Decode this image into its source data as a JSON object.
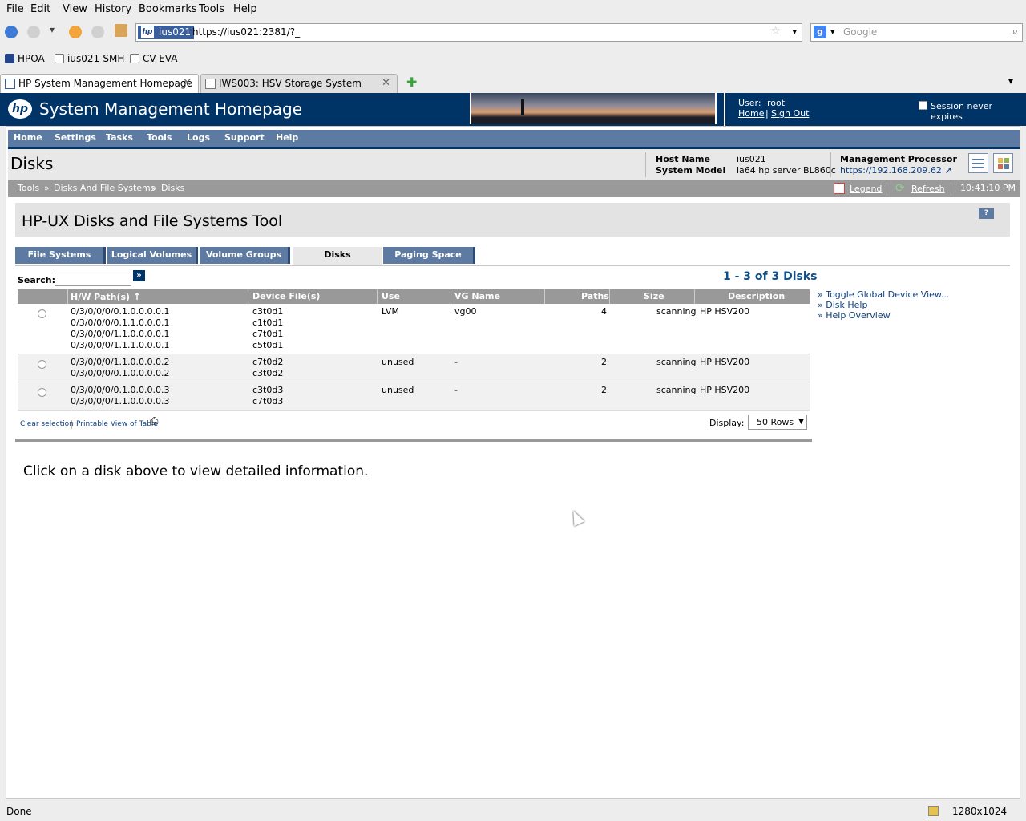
{
  "browser": {
    "menu": [
      "File",
      "Edit",
      "View",
      "History",
      "Bookmarks",
      "Tools",
      "Help"
    ],
    "url_badge": "ius021",
    "url": "https://ius021:2381/?_",
    "search_placeholder": "Google",
    "bookmarks": [
      "HPOA",
      "ius021-SMH",
      "CV-EVA"
    ],
    "tabs": [
      "HP System Management Homepage",
      "IWS003: HSV Storage System"
    ],
    "status": "Done",
    "resolution": "1280x1024"
  },
  "header": {
    "logo": "hp",
    "title": "System Management Homepage",
    "user_label": "User:",
    "user": "root",
    "home_link": "Home",
    "signout_link": "Sign Out",
    "session_label": "Session never expires"
  },
  "mainnav": [
    "Home",
    "Settings",
    "Tasks",
    "Tools",
    "Logs",
    "Support",
    "Help"
  ],
  "page": {
    "title": "Disks",
    "host_name_label": "Host Name",
    "host_name": "ius021",
    "system_model_label": "System Model",
    "system_model": "ia64 hp server BL860c",
    "mp_label": "Management Processor",
    "mp_link": "https://192.168.209.62"
  },
  "breadcrumb": [
    "Tools",
    "Disks And File Systems",
    "Disks"
  ],
  "crumb_tools": {
    "legend": "Legend",
    "refresh": "Refresh",
    "time": "10:41:10 PM"
  },
  "tool": {
    "title": "HP-UX Disks and File Systems Tool",
    "help_icon": "?",
    "tabs": [
      "File Systems",
      "Logical Volumes",
      "Volume Groups",
      "Disks",
      "Paging Space"
    ],
    "search_label": "Search:",
    "count_text": "1 - 3 of 3 Disks"
  },
  "table": {
    "columns": [
      "H/W Path(s)",
      "Device File(s)",
      "Use",
      "VG Name",
      "Paths",
      "Size",
      "Description"
    ],
    "rows": [
      {
        "hw": [
          "0/3/0/0/0/0.1.0.0.0.0.1",
          "0/3/0/0/0/0.1.1.0.0.0.1",
          "0/3/0/0/0/1.1.0.0.0.0.1",
          "0/3/0/0/0/1.1.1.0.0.0.1"
        ],
        "dev": [
          "c3t0d1",
          "c1t0d1",
          "c7t0d1",
          "c5t0d1"
        ],
        "use": "LVM",
        "vg": "vg00",
        "paths": "4",
        "size": "scanning",
        "desc": "HP HSV200"
      },
      {
        "hw": [
          "0/3/0/0/0/1.1.0.0.0.0.2",
          "0/3/0/0/0/0.1.0.0.0.0.2"
        ],
        "dev": [
          "c7t0d2",
          "c3t0d2"
        ],
        "use": "unused",
        "vg": "-",
        "paths": "2",
        "size": "scanning",
        "desc": "HP HSV200"
      },
      {
        "hw": [
          "0/3/0/0/0/0.1.0.0.0.0.3",
          "0/3/0/0/0/1.1.0.0.0.0.3"
        ],
        "dev": [
          "c3t0d3",
          "c7t0d3"
        ],
        "use": "unused",
        "vg": "-",
        "paths": "2",
        "size": "scanning",
        "desc": "HP HSV200"
      }
    ]
  },
  "table_footer": {
    "clear": "Clear selection",
    "sep": "|",
    "printable": "Printable View of Table",
    "display_label": "Display:",
    "display_value": "50 Rows"
  },
  "side_links": [
    "» Toggle Global Device View...",
    "» Disk Help",
    "» Help Overview"
  ],
  "detail_msg": "Click on a disk above to view detailed information."
}
